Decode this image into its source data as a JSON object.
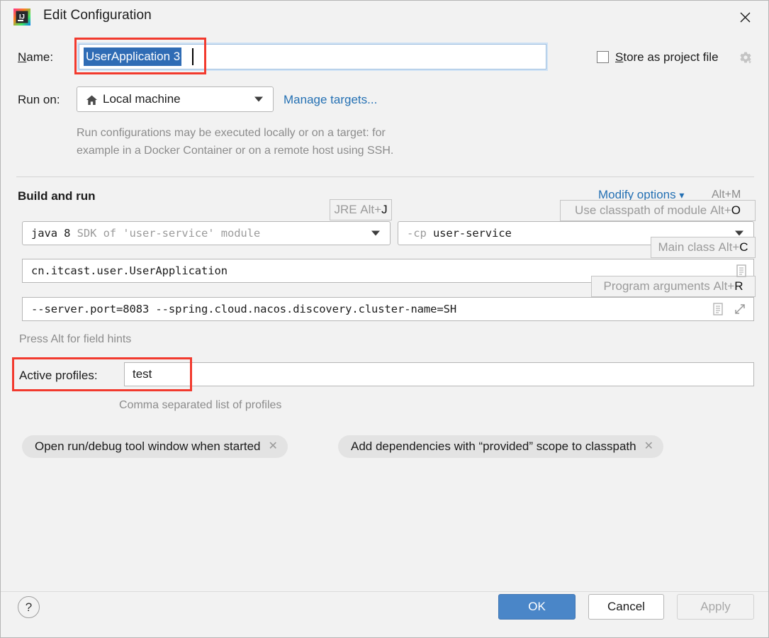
{
  "window": {
    "title": "Edit Configuration",
    "app_icon": "intellij-idea-logo",
    "close_icon": "close-icon"
  },
  "name_row": {
    "label": "Name:",
    "label_mnemonic": "N",
    "value": "UserApplication 3",
    "selected": true,
    "store_as_project_file": {
      "label": "Store as project file",
      "label_mnemonic": "S",
      "checked": false,
      "gear_icon": "gear-icon"
    }
  },
  "run_on": {
    "label": "Run on:",
    "value": "Local machine",
    "value_icon": "home-icon",
    "manage_targets_link": "Manage targets...",
    "description_line1": "Run configurations may be executed locally or on a target: for",
    "description_line2": "example in a Docker Container or on a remote host using SSH."
  },
  "build_and_run": {
    "section_title": "Build and run",
    "modify_options": {
      "label": "Modify options",
      "chevron_icon": "chevron-down-icon",
      "shortcut": "Alt+M"
    },
    "jre": {
      "hint_label": "JRE",
      "hint_shortcut_prefix": "Alt+",
      "hint_shortcut_key": "J",
      "value_bold": "java 8",
      "value_dim": "SDK of 'user-service' module"
    },
    "classpath": {
      "hint_label": "Use classpath of module",
      "hint_shortcut_prefix": "Alt+",
      "hint_shortcut_key": "O",
      "value_dim": "-cp",
      "value_bold": "user-service"
    },
    "main_class": {
      "hint_label": "Main class",
      "hint_shortcut_prefix": "Alt+",
      "hint_shortcut_key": "C",
      "value": "cn.itcast.user.UserApplication",
      "list_icon": "list-icon"
    },
    "program_arguments": {
      "hint_label": "Program arguments",
      "hint_shortcut_prefix": "Alt+",
      "hint_shortcut_key": "R",
      "value": "--server.port=8083 --spring.cloud.nacos.discovery.cluster-name=SH",
      "list_icon": "list-icon",
      "expand_icon": "expand-icon"
    },
    "field_hints_note": "Press Alt for field hints"
  },
  "active_profiles": {
    "label": "Active profiles:",
    "value": "test",
    "hint": "Comma separated list of profiles"
  },
  "option_chips": [
    {
      "label": "Open run/debug tool window when started",
      "close_icon": "close-icon"
    },
    {
      "label": "Add dependencies with “provided” scope to classpath",
      "close_icon": "close-icon"
    }
  ],
  "footer": {
    "help_label": "?",
    "ok_label": "OK",
    "cancel_label": "Cancel",
    "apply_label": "Apply",
    "apply_disabled": true
  },
  "colors": {
    "background": "#f2f2f2",
    "accent_link": "#2470b3",
    "primary_button": "#4a86c8",
    "selection": "#2f6cb5",
    "annotation": "#f23a2e"
  }
}
